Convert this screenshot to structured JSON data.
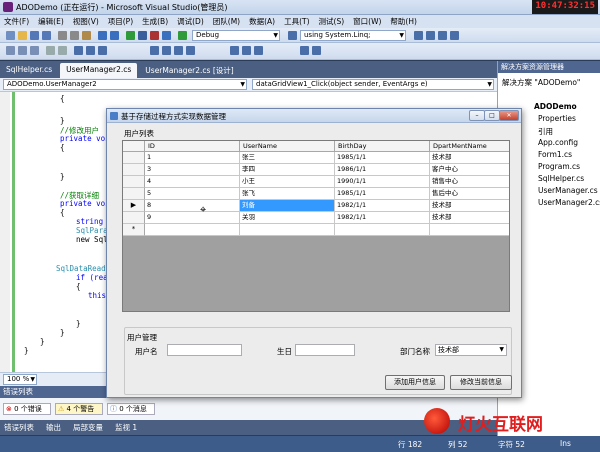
{
  "window": {
    "title": "ADODemo (正在运行) - Microsoft Visual Studio(管理员)",
    "clock": "10:47:32:15"
  },
  "menu": [
    "文件(F)",
    "编辑(E)",
    "视图(V)",
    "项目(P)",
    "生成(B)",
    "调试(D)",
    "团队(M)",
    "数据(A)",
    "工具(T)",
    "测试(S)",
    "窗口(W)",
    "帮助(H)"
  ],
  "toolbar": {
    "config": "Debug",
    "find": "using System.Linq;"
  },
  "tabs": [
    {
      "label": "SqlHelper.cs"
    },
    {
      "label": "UserManager2.cs"
    },
    {
      "label": "UserManager2.cs [设计]"
    }
  ],
  "codenav": {
    "class": "ADODemo.UserManager2",
    "member": "dataGridView1_Click(object sender, EventArgs e)"
  },
  "code": {
    "l1": "{",
    "l2": "}",
    "l3": "//修改用户",
    "l4": "private voi",
    "l5": "{",
    "l6": "}",
    "l7": "//获取详细",
    "l8": "private voi",
    "l9": "{",
    "l10": "string",
    "l11": "SqlPara",
    "l12": "new Sql",
    "l13": "SqlDataReade",
    "l14": "if (read",
    "l15": "{",
    "l16": "this",
    "l17": "}",
    "l18": "}",
    "l19": "}",
    "l20": "}"
  },
  "zoom": "100 %",
  "errors": {
    "header": "错误列表",
    "errors": "0 个错误",
    "warnings": "4 个警告",
    "messages": "0 个消息"
  },
  "bottom_tabs": [
    "错误列表",
    "输出",
    "局部变量",
    "监视 1"
  ],
  "status": {
    "row": "行 182",
    "col": "列 52",
    "char": "字符 52",
    "mode": "Ins"
  },
  "solution": {
    "header": "解决方案资源管理器",
    "root": "解决方案 \"ADODemo\"",
    "project": "ADODemo",
    "items": [
      "Properties",
      "引用",
      "App.config",
      "Form1.cs",
      "Program.cs",
      "SqlHelper.cs",
      "UserManager.cs",
      "UserManager2.cs"
    ]
  },
  "dialog": {
    "title": "基于存储过程方式实现数据管理",
    "list_group": "用户列表",
    "columns": [
      "ID",
      "UserName",
      "BirthDay",
      "DpartMentName"
    ],
    "rows": [
      [
        "1",
        "张三",
        "1985/1/1",
        "技术部"
      ],
      [
        "3",
        "李四",
        "1986/1/1",
        "客户中心"
      ],
      [
        "4",
        "小王",
        "1990/1/1",
        "销售中心"
      ],
      [
        "5",
        "张飞",
        "1985/1/1",
        "售后中心"
      ],
      [
        "8",
        "刘备",
        "1982/1/1",
        "技术部"
      ],
      [
        "9",
        "关羽",
        "1982/1/1",
        "技术部"
      ]
    ],
    "manage_group": "用户管理",
    "username_label": "用户名",
    "birthday_label": "生日",
    "dept_label": "部门名称",
    "dept_value": "技术部",
    "add_button": "添加用户信息",
    "edit_button": "修改当前信息"
  },
  "watermark": "灯火互联网"
}
